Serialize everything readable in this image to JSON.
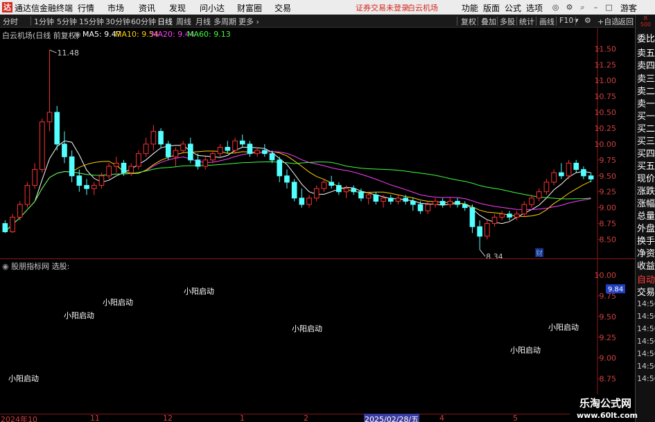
{
  "app": {
    "logo": "达",
    "name": "通达信金融终端",
    "menus": [
      "行情",
      "市场",
      "资讯",
      "发现",
      "问小达",
      "财富圈",
      "交易"
    ],
    "notice": "证券交易未登录",
    "stock_name": "白云机场",
    "right_buttons": [
      "功能",
      "版面",
      "公式",
      "选项"
    ],
    "guest": "游客",
    "window_icons": [
      "compass-icon",
      "settings-icon",
      "search-icon",
      "minimize-icon",
      "maximize-icon",
      "close-icon"
    ]
  },
  "toolbar": {
    "periods": [
      "分时",
      "1分钟",
      "5分钟",
      "15分钟",
      "30分钟",
      "60分钟",
      "日线",
      "周线",
      "月线",
      "多周期",
      "更多 ›"
    ],
    "active_period": "日线",
    "buttons": [
      "复权",
      "叠加",
      "多股",
      "统计",
      "画线",
      "F10",
      "标记",
      "+自选",
      "返回"
    ]
  },
  "chart_header": {
    "title": "白云机场(日线 前复权)",
    "ma_items": [
      {
        "label": "MA5: 9.47",
        "color": "#ffffff"
      },
      {
        "label": "MA10: 9.54",
        "color": "#ffd200"
      },
      {
        "label": "MA20: 9.44",
        "color": "#ff40ff"
      },
      {
        "label": "MA60: 9.13",
        "color": "#40ff40"
      }
    ]
  },
  "sub_header": {
    "title": "股朋指标网 选股:"
  },
  "side_panel": {
    "badge_r": "R",
    "badge_code": "500",
    "items": [
      "委比",
      "卖五",
      "卖四",
      "卖三",
      "卖二",
      "卖一",
      "买一",
      "买二",
      "买三",
      "买四",
      "买五",
      "现价",
      "涨跌",
      "涨幅",
      "总量",
      "外盘",
      "换手",
      "净资",
      "收益"
    ],
    "sub_items": [
      "自动",
      "交易"
    ],
    "times": [
      "14:56",
      "14:56",
      "14:56",
      "14:56",
      "14:56",
      "14:56",
      "14:56"
    ]
  },
  "chart_data": {
    "type": "candlestick",
    "title": "白云机场(日线 前复权)",
    "price_axis": {
      "ticks": [
        "11.50",
        "11.25",
        "11.00",
        "10.75",
        "10.50",
        "10.25",
        "10.00",
        "9.75",
        "9.50",
        "9.25",
        "9.00",
        "8.75",
        "8.50"
      ],
      "range": [
        8.32,
        11.7
      ]
    },
    "annotations": {
      "high": "11.48",
      "low": "8.34",
      "event_badge": "财"
    },
    "ohlc": [
      [
        8.75,
        8.8,
        8.6,
        8.62
      ],
      [
        8.62,
        8.9,
        8.6,
        8.85
      ],
      [
        8.85,
        9.1,
        8.8,
        9.05
      ],
      [
        9.05,
        9.4,
        9.0,
        9.35
      ],
      [
        9.35,
        9.7,
        9.3,
        9.6
      ],
      [
        9.6,
        10.4,
        9.55,
        10.35
      ],
      [
        10.35,
        11.48,
        10.2,
        10.5
      ],
      [
        10.5,
        10.6,
        9.9,
        10.0
      ],
      [
        10.0,
        10.2,
        9.7,
        9.8
      ],
      [
        9.8,
        9.9,
        9.4,
        9.5
      ],
      [
        9.5,
        9.6,
        9.25,
        9.35
      ],
      [
        9.35,
        9.45,
        9.2,
        9.3
      ],
      [
        9.3,
        9.4,
        9.2,
        9.35
      ],
      [
        9.35,
        9.55,
        9.3,
        9.5
      ],
      [
        9.5,
        9.7,
        9.45,
        9.65
      ],
      [
        9.65,
        9.8,
        9.55,
        9.7
      ],
      [
        9.7,
        9.75,
        9.5,
        9.55
      ],
      [
        9.55,
        9.7,
        9.5,
        9.65
      ],
      [
        9.65,
        9.9,
        9.6,
        9.85
      ],
      [
        9.85,
        10.1,
        9.8,
        10.0
      ],
      [
        10.0,
        10.3,
        9.9,
        10.2
      ],
      [
        10.2,
        10.25,
        9.95,
        10.0
      ],
      [
        10.0,
        10.05,
        9.75,
        9.8
      ],
      [
        9.8,
        9.95,
        9.65,
        9.9
      ],
      [
        9.9,
        10.05,
        9.85,
        10.0
      ],
      [
        10.0,
        10.1,
        9.7,
        9.75
      ],
      [
        9.75,
        9.85,
        9.6,
        9.65
      ],
      [
        9.65,
        9.8,
        9.6,
        9.75
      ],
      [
        9.75,
        9.9,
        9.7,
        9.85
      ],
      [
        9.85,
        10.0,
        9.8,
        9.95
      ],
      [
        9.95,
        10.05,
        9.85,
        9.9
      ],
      [
        9.9,
        10.1,
        9.85,
        10.05
      ],
      [
        10.05,
        10.15,
        9.95,
        10.0
      ],
      [
        10.0,
        10.05,
        9.8,
        9.85
      ],
      [
        9.85,
        9.95,
        9.8,
        9.9
      ],
      [
        9.9,
        10.0,
        9.8,
        9.85
      ],
      [
        9.85,
        9.9,
        9.7,
        9.75
      ],
      [
        9.75,
        9.8,
        9.4,
        9.5
      ],
      [
        9.5,
        9.6,
        9.3,
        9.4
      ],
      [
        9.4,
        9.45,
        9.1,
        9.15
      ],
      [
        9.15,
        9.3,
        9.0,
        9.05
      ],
      [
        9.05,
        9.2,
        9.0,
        9.15
      ],
      [
        9.15,
        9.35,
        9.1,
        9.3
      ],
      [
        9.3,
        9.45,
        9.25,
        9.4
      ],
      [
        9.4,
        9.5,
        9.3,
        9.35
      ],
      [
        9.35,
        9.4,
        9.2,
        9.25
      ],
      [
        9.25,
        9.35,
        9.15,
        9.3
      ],
      [
        9.3,
        9.35,
        9.2,
        9.25
      ],
      [
        9.25,
        9.3,
        9.1,
        9.15
      ],
      [
        9.15,
        9.25,
        9.05,
        9.2
      ],
      [
        9.2,
        9.25,
        9.05,
        9.1
      ],
      [
        9.1,
        9.2,
        9.0,
        9.15
      ],
      [
        9.15,
        9.2,
        9.05,
        9.1
      ],
      [
        9.1,
        9.2,
        9.05,
        9.15
      ],
      [
        9.15,
        9.2,
        9.05,
        9.1
      ],
      [
        9.1,
        9.15,
        8.95,
        9.05
      ],
      [
        9.05,
        9.1,
        8.9,
        8.95
      ],
      [
        8.95,
        9.1,
        8.9,
        9.05
      ],
      [
        9.05,
        9.15,
        9.0,
        9.1
      ],
      [
        9.1,
        9.15,
        9.0,
        9.05
      ],
      [
        9.05,
        9.15,
        9.0,
        9.1
      ],
      [
        9.1,
        9.15,
        9.0,
        9.05
      ],
      [
        9.05,
        9.1,
        8.95,
        9.0
      ],
      [
        9.0,
        9.05,
        8.6,
        8.7
      ],
      [
        8.7,
        8.8,
        8.34,
        8.55
      ],
      [
        8.55,
        8.8,
        8.5,
        8.75
      ],
      [
        8.75,
        8.9,
        8.7,
        8.85
      ],
      [
        8.85,
        8.95,
        8.8,
        8.9
      ],
      [
        8.9,
        8.95,
        8.8,
        8.85
      ],
      [
        8.85,
        8.95,
        8.8,
        8.9
      ],
      [
        8.9,
        9.1,
        8.85,
        9.05
      ],
      [
        9.05,
        9.2,
        9.0,
        9.15
      ],
      [
        9.15,
        9.3,
        9.1,
        9.25
      ],
      [
        9.25,
        9.45,
        9.2,
        9.4
      ],
      [
        9.4,
        9.6,
        9.35,
        9.55
      ],
      [
        9.55,
        9.7,
        9.45,
        9.5
      ],
      [
        9.5,
        9.75,
        9.45,
        9.7
      ],
      [
        9.7,
        9.75,
        9.55,
        9.6
      ],
      [
        9.6,
        9.65,
        9.45,
        9.5
      ],
      [
        9.5,
        9.55,
        9.4,
        9.45
      ]
    ],
    "ma_lines": [
      {
        "name": "MA5",
        "color": "#ffffff"
      },
      {
        "name": "MA10",
        "color": "#ffd200"
      },
      {
        "name": "MA20",
        "color": "#ff40ff"
      },
      {
        "name": "MA60",
        "color": "#40ff40"
      }
    ],
    "sub_axis": {
      "ticks": [
        "10.00",
        "9.75",
        "9.50",
        "9.25",
        "9.00",
        "8.75"
      ],
      "range": [
        8.62,
        10.06
      ],
      "current_value": "9.84"
    },
    "signals": [
      {
        "label": "小阳启动",
        "price": 8.7,
        "bar": 1
      },
      {
        "label": "小阳启动",
        "price": 9.37,
        "bar": 12
      },
      {
        "label": "小阳启动",
        "price": 9.62,
        "bar": 20
      },
      {
        "label": "小阳启动",
        "price": 9.85,
        "bar": 31
      },
      {
        "label": "小阳启动",
        "price": 9.3,
        "bar": 48
      },
      {
        "label": "小阳启动",
        "price": 8.86,
        "bar": 75
      },
      {
        "label": "小阳启动",
        "price": 9.31,
        "bar": 80
      }
    ],
    "date_ticks": [
      {
        "label": "2024年10",
        "bar": 0
      },
      {
        "label": "11",
        "bar": 15
      },
      {
        "label": "12",
        "bar": 27
      },
      {
        "label": "1",
        "bar": 39
      },
      {
        "label": "2",
        "bar": 49
      },
      {
        "label": "2025/02/28/五",
        "bar": 59,
        "highlight": true
      },
      {
        "label": "4",
        "bar": 72
      },
      {
        "label": "5",
        "bar": 84
      }
    ]
  },
  "watermark": {
    "line1": "乐淘公式网",
    "line2": "www.60lt.com"
  }
}
